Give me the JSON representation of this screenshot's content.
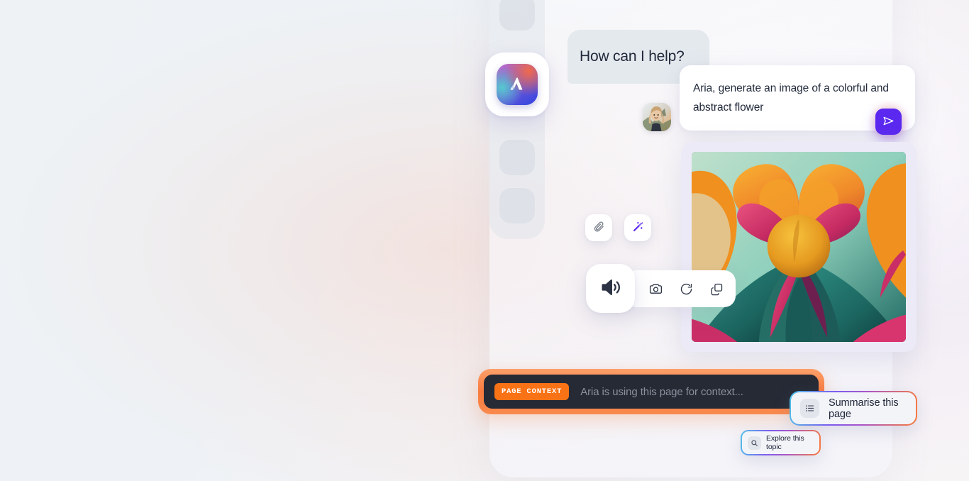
{
  "app": {
    "name": "Aria",
    "logo_icon": "aria-logo-icon"
  },
  "sidebar": {
    "placeholders": 3
  },
  "conversation": {
    "greeting": "How can I help?",
    "avatar_icon": "user-avatar",
    "prompt": "Aria, generate an image of a colorful and abstract flower",
    "send_icon": "send-icon",
    "generated_image_alt": "abstract colorful flower illustration"
  },
  "composer": {
    "attach_icon": "paperclip-icon",
    "wand_icon": "magic-wand-icon"
  },
  "answer_actions": {
    "speak_icon": "speaker-icon",
    "items": [
      {
        "icon": "camera-icon",
        "name": "camera"
      },
      {
        "icon": "refresh-icon",
        "name": "regenerate"
      },
      {
        "icon": "copy-icon",
        "name": "copy"
      }
    ]
  },
  "page_context": {
    "badge": "PAGE CONTEXT",
    "placeholder": "Aria is using this page for context..."
  },
  "suggestions": [
    {
      "label": "Summarise this page",
      "icon": "list-icon"
    },
    {
      "label": "Explore this topic",
      "icon": "search-icon"
    }
  ],
  "colors": {
    "background": "#eef2f5",
    "accent_purple": "#5b28ef",
    "accent_orange": "#f97316",
    "context_dark": "#252a35",
    "text_primary": "#21293a",
    "text_muted": "#8b909c"
  }
}
